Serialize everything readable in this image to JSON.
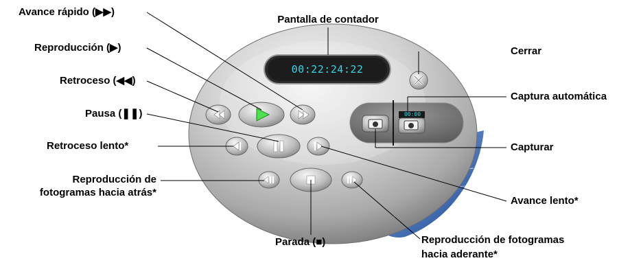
{
  "player": {
    "counter": "00:22:24:22",
    "auto_counter": "00:00"
  },
  "labels": {
    "fast_forward": "Avance rápido (▶▶)",
    "counter_display": "Pantalla de contador",
    "play": "Reproducción (▶)",
    "close": "Cerrar",
    "rewind": "Retroceso (◀◀)",
    "auto_capture": "Captura automática",
    "pause": "Pausa (❚❚)",
    "slow_rewind": "Retroceso lento*",
    "capture": "Capturar",
    "frame_back_line1": "Reproducción de",
    "frame_back_line2": "fotogramas hacia atrás*",
    "slow_forward": "Avance lento*",
    "stop": "Parada (■)",
    "frame_forward_line1": "Reproducción de fotogramas",
    "frame_forward_line2": "hacia aderante*"
  }
}
